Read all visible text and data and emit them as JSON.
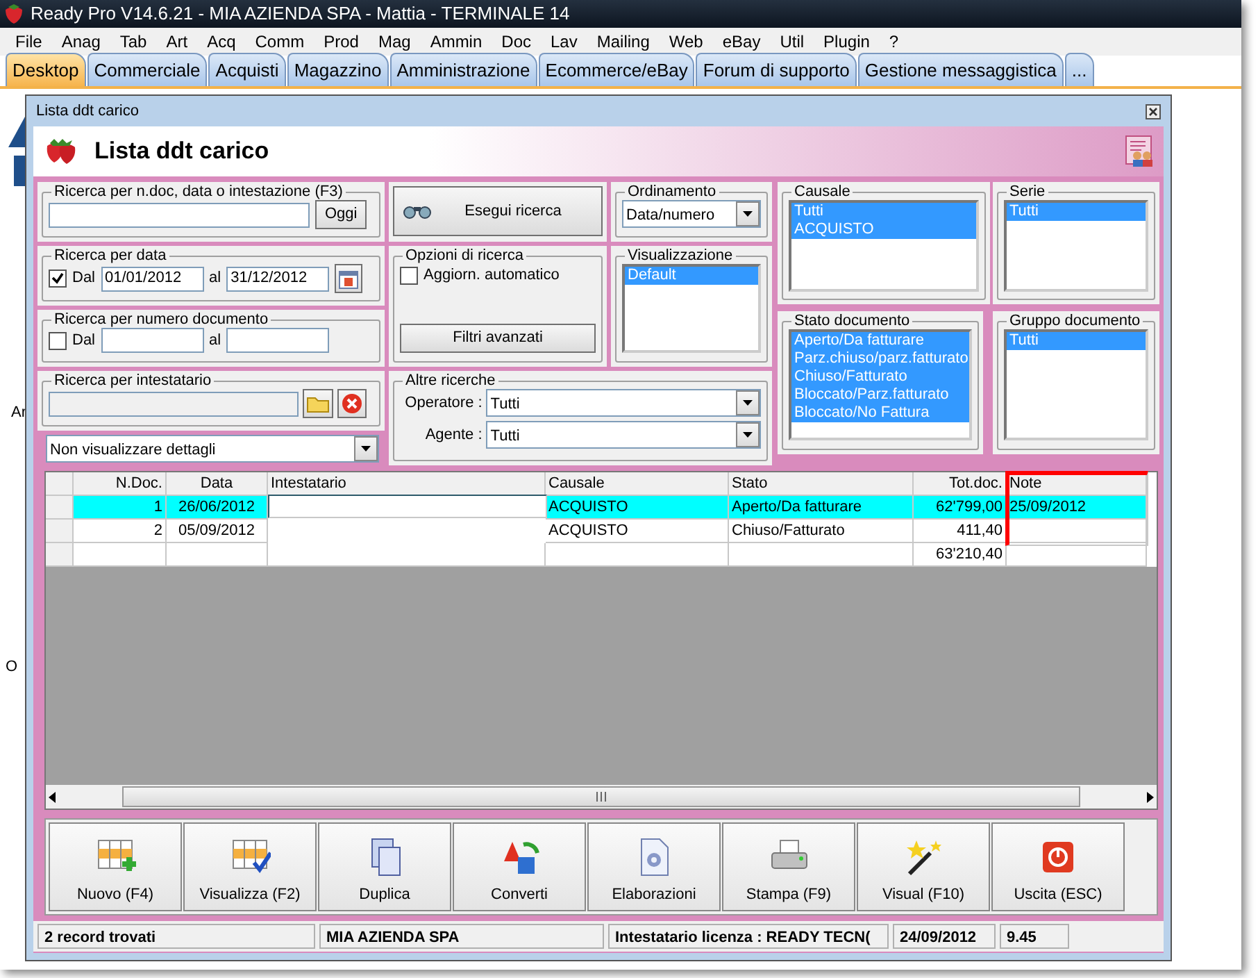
{
  "app": {
    "title": "Ready Pro V14.6.21 - MIA AZIENDA SPA - Mattia - TERMINALE 14"
  },
  "menu": [
    "File",
    "Anag",
    "Tab",
    "Art",
    "Acq",
    "Comm",
    "Prod",
    "Mag",
    "Ammin",
    "Doc",
    "Lav",
    "Mailing",
    "Web",
    "eBay",
    "Util",
    "Plugin",
    "?"
  ],
  "tabs": [
    {
      "label": "Desktop",
      "selected": true
    },
    {
      "label": "Commerciale",
      "selected": false
    },
    {
      "label": "Acquisti",
      "selected": false
    },
    {
      "label": "Magazzino",
      "selected": false
    },
    {
      "label": "Amministrazione",
      "selected": false
    },
    {
      "label": "Ecommerce/eBay",
      "selected": false
    },
    {
      "label": "Forum di supporto",
      "selected": false
    },
    {
      "label": "Gestione messaggistica",
      "selected": false
    },
    {
      "label": "...",
      "selected": false
    }
  ],
  "desktop_labels": [
    "Ar",
    "O"
  ],
  "window": {
    "title": "Lista ddt carico",
    "heading": "Lista ddt carico"
  },
  "filters": {
    "quick_search": {
      "legend": "Ricerca per n.doc, data o intestazione (F3)",
      "button": "Oggi"
    },
    "search_button": "Esegui ricerca",
    "ordering": {
      "legend": "Ordinamento",
      "value": "Data/numero"
    },
    "date_search": {
      "legend": "Ricerca per data",
      "checked": true,
      "from_label": "Dal",
      "from": "01/01/2012",
      "to_label": "al",
      "to": "31/12/2012"
    },
    "number_search": {
      "legend": "Ricerca per numero documento",
      "checked": false,
      "from_label": "Dal",
      "to_label": "al"
    },
    "options": {
      "legend": "Opzioni di ricerca",
      "auto_label": "Aggiorn. automatico",
      "auto_checked": false,
      "button": "Filtri avanzati"
    },
    "view": {
      "legend": "Visualizzazione",
      "items": [
        {
          "label": "Default",
          "selected": true
        }
      ]
    },
    "holder_search": {
      "legend": "Ricerca per intestatario"
    },
    "detail": {
      "value": "Non visualizzare dettagli"
    },
    "other": {
      "legend": "Altre ricerche",
      "fields": [
        {
          "label": "Operatore :",
          "value": "Tutti"
        },
        {
          "label": "Agente :",
          "value": "Tutti"
        }
      ]
    },
    "causale": {
      "legend": "Causale",
      "items": [
        {
          "label": "Tutti",
          "selected": true
        },
        {
          "label": "ACQUISTO",
          "selected": true
        }
      ]
    },
    "serie": {
      "legend": "Serie",
      "items": [
        {
          "label": "Tutti",
          "selected": true
        }
      ]
    },
    "stato": {
      "legend": "Stato documento",
      "items": [
        {
          "label": "Aperto/Da fatturare",
          "selected": true
        },
        {
          "label": "Parz.chiuso/parz.fatturato",
          "selected": true
        },
        {
          "label": "Chiuso/Fatturato",
          "selected": true
        },
        {
          "label": "Bloccato/Parz.fatturato",
          "selected": true
        },
        {
          "label": "Bloccato/No Fattura",
          "selected": true
        }
      ]
    },
    "gruppo": {
      "legend": "Gruppo documento",
      "items": [
        {
          "label": "Tutti",
          "selected": true
        }
      ]
    }
  },
  "table": {
    "columns": [
      {
        "label": "N.Doc.",
        "highlighted": false
      },
      {
        "label": "Data",
        "highlighted": false
      },
      {
        "label": "Intestatario",
        "highlighted": false
      },
      {
        "label": "Causale",
        "highlighted": false
      },
      {
        "label": "Stato",
        "highlighted": false
      },
      {
        "label": "Tot.doc.",
        "highlighted": false
      },
      {
        "label": "Note",
        "highlighted": true
      }
    ],
    "rows": [
      {
        "selected": true,
        "cells": [
          "1",
          "26/06/2012",
          "",
          "ACQUISTO",
          "Aperto/Da fatturare",
          "62'799,00",
          "25/09/2012"
        ]
      },
      {
        "selected": false,
        "cells": [
          "2",
          "05/09/2012",
          "",
          "ACQUISTO",
          "Chiuso/Fatturato",
          "411,40",
          ""
        ]
      },
      {
        "selected": false,
        "cells": [
          "",
          "",
          "",
          "",
          "",
          "63'210,40",
          ""
        ]
      }
    ]
  },
  "buttons": [
    {
      "label": "Nuovo (F4)",
      "kind": "new"
    },
    {
      "label": "Visualizza (F2)",
      "kind": "view"
    },
    {
      "label": "Duplica",
      "kind": "copy"
    },
    {
      "label": "Converti",
      "kind": "convert"
    },
    {
      "label": "Elaborazioni",
      "kind": "process"
    },
    {
      "label": "Stampa (F9)",
      "kind": "print"
    },
    {
      "label": "Visual (F10)",
      "kind": "wand"
    },
    {
      "label": "Uscita (ESC)",
      "kind": "exit"
    }
  ],
  "status_bar": [
    "2 record trovati",
    "MIA AZIENDA SPA",
    "Intestatario licenza : READY TECN(",
    "24/09/2012",
    "9.45"
  ]
}
